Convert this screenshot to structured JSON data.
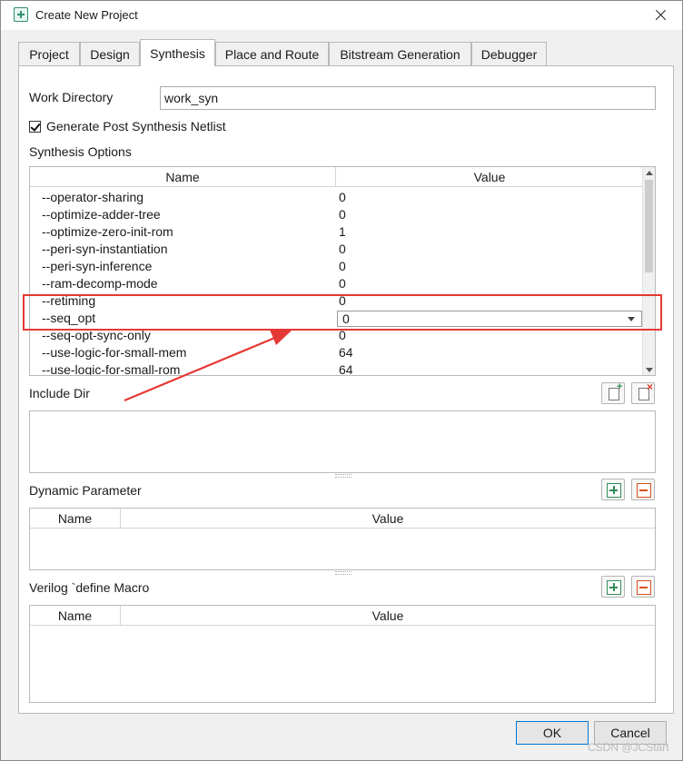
{
  "window": {
    "title": "Create New Project"
  },
  "tabs": [
    {
      "label": "Project"
    },
    {
      "label": "Design"
    },
    {
      "label": "Synthesis"
    },
    {
      "label": "Place and Route"
    },
    {
      "label": "Bitstream Generation"
    },
    {
      "label": "Debugger"
    }
  ],
  "active_tab": "Synthesis",
  "work_directory": {
    "label": "Work Directory",
    "value": "work_syn"
  },
  "generate_netlist": {
    "label": "Generate Post Synthesis Netlist",
    "checked": true
  },
  "synthesis_options": {
    "label": "Synthesis Options",
    "columns": {
      "name": "Name",
      "value": "Value"
    },
    "rows": [
      {
        "name": "--operator-sharing",
        "value": "0"
      },
      {
        "name": "--optimize-adder-tree",
        "value": "0"
      },
      {
        "name": "--optimize-zero-init-rom",
        "value": "1"
      },
      {
        "name": "--peri-syn-instantiation",
        "value": "0"
      },
      {
        "name": "--peri-syn-inference",
        "value": "0"
      },
      {
        "name": "--ram-decomp-mode",
        "value": "0"
      },
      {
        "name": "--retiming",
        "value": "0"
      },
      {
        "name": "--seq_opt",
        "value": "0"
      },
      {
        "name": "--seq-opt-sync-only",
        "value": "0"
      },
      {
        "name": "--use-logic-for-small-mem",
        "value": "64"
      },
      {
        "name": "--use-logic-for-small-rom",
        "value": "64"
      }
    ],
    "editing_row": "--seq_opt"
  },
  "include_dir": {
    "label": "Include Dir"
  },
  "dynamic_parameter": {
    "label": "Dynamic Parameter",
    "columns": {
      "name": "Name",
      "value": "Value"
    }
  },
  "verilog_macro": {
    "label": "Verilog `define Macro",
    "columns": {
      "name": "Name",
      "value": "Value"
    }
  },
  "buttons": {
    "ok": "OK",
    "cancel": "Cancel"
  },
  "watermark": "CSDN @JCStart",
  "colors": {
    "annotation": "#e53935",
    "accent": "#0078d7"
  }
}
